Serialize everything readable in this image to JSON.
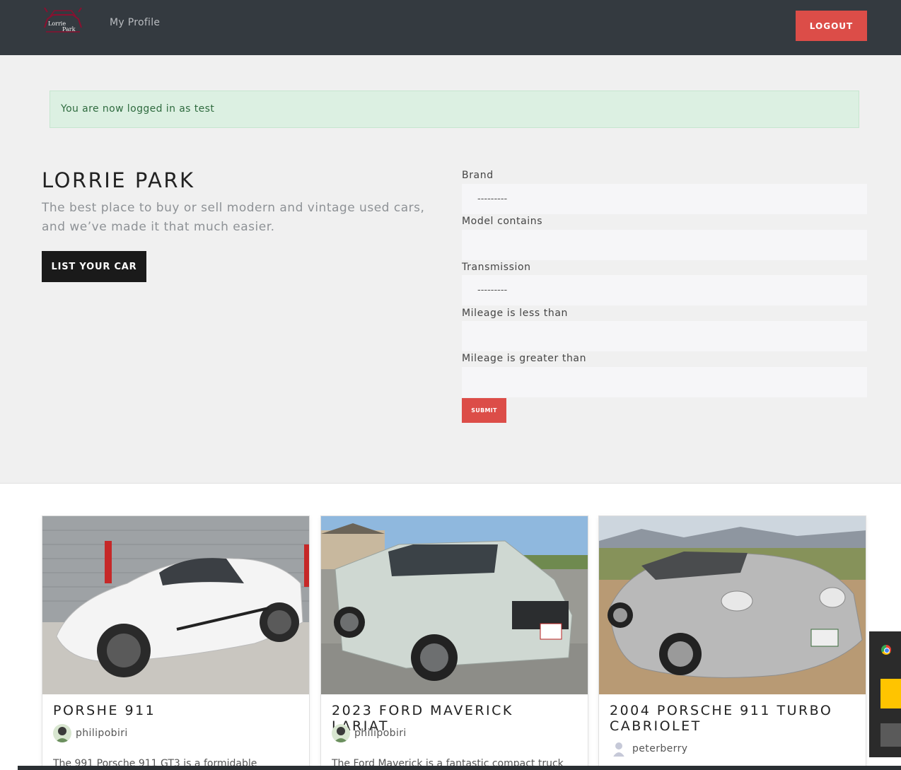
{
  "navbar": {
    "logo_line1": "Lorrie",
    "logo_line2": "Park",
    "my_profile": "My Profile",
    "logout": "LOGOUT"
  },
  "alert": {
    "message": "You are now logged in as test"
  },
  "hero": {
    "title": "LORRIE PARK",
    "tagline": "The best place to buy or sell modern and vintage used cars, and we’ve made it that much easier.",
    "list_button": "LIST YOUR CAR"
  },
  "filter_form": {
    "brand_label": "Brand",
    "brand_value": "---------",
    "model_label": "Model contains",
    "model_value": "",
    "transmission_label": "Transmission",
    "transmission_value": "---------",
    "mileage_less_label": "Mileage is less than",
    "mileage_less_value": "",
    "mileage_greater_label": "Mileage is greater than",
    "mileage_greater_value": "",
    "submit": "SUBMIT"
  },
  "cars": [
    {
      "title": "PORSHE 911",
      "author": "philipobiri",
      "description": "The 991 Porsche 911 GT3 is a formidable"
    },
    {
      "title": "2023 FORD MAVERICK LARIAT",
      "author": "philipobiri",
      "description": "The Ford Maverick is a fantastic compact truck"
    },
    {
      "title": "2004 PORSCHE 911 TURBO CABRIOLET",
      "author": "peterberry",
      "description": ""
    }
  ],
  "colors": {
    "navbar_bg": "#343a40",
    "accent_red": "#dc4d48",
    "hero_bg": "#f0f0f0",
    "alert_bg": "#dcf0e2",
    "alert_text": "#2f6b3f"
  }
}
